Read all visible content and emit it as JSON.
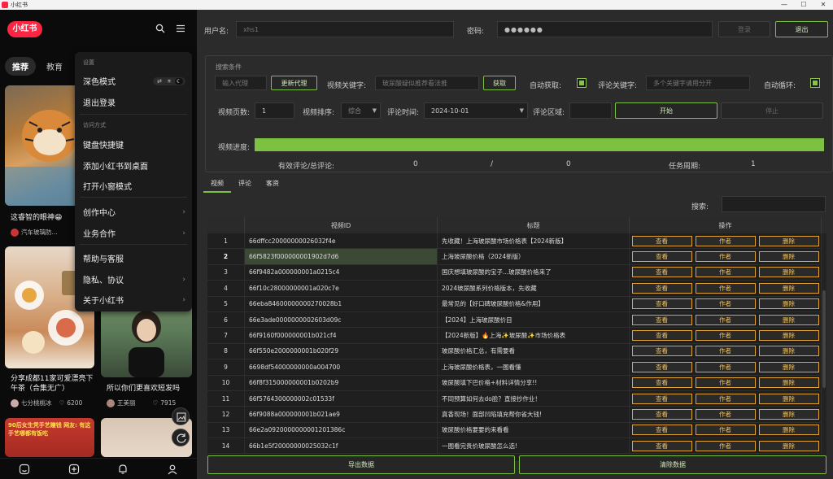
{
  "window": {
    "title": "小红书",
    "controls": [
      "—",
      "☐",
      "✕"
    ]
  },
  "left": {
    "logo": "小红书",
    "tabs": [
      {
        "label": "推荐",
        "active": true
      },
      {
        "label": "教育",
        "active": false
      }
    ],
    "cards": [
      {
        "title": "这睿智的眼神😁",
        "author": "汽车玻璃防..."
      },
      {
        "title": "分享成都11家可爱漂亮下午茶（合集无广）",
        "author": "七分桃桃冰",
        "likes": "6200"
      },
      {
        "title": "所以你们更喜欢短发吗",
        "author": "王美丽",
        "likes": "7915"
      },
      {
        "title": "90后女生凭手艺赚钱 网友: 有这手艺哪都有饭吃",
        "author": ""
      }
    ],
    "menu": {
      "section_settings": "设置",
      "dark_mode": "深色模式",
      "logout": "退出登录",
      "section_access": "访问方式",
      "shortcuts": "键盘快捷键",
      "add_desktop": "添加小红书到桌面",
      "mini_window": "打开小窗模式",
      "creator": "创作中心",
      "business": "业务合作",
      "help": "帮助与客服",
      "privacy": "隐私、协议",
      "about": "关于小红书",
      "chevron": "›",
      "theme_options": [
        "⇄",
        "☀",
        "☾"
      ]
    }
  },
  "right": {
    "username_label": "用户名:",
    "username_value": "xhs1",
    "password_label": "密码:",
    "password_value": "●●●●●●",
    "login_btn": "登录",
    "logout_btn": "退出",
    "search_cond": "搜索条件",
    "proxy_placeholder": "输入代理",
    "update_proxy": "更新代理",
    "video_kw_label": "视频关键字:",
    "video_kw_value": "玻尿酸疑似推荐看法推",
    "fetch_btn": "获取",
    "auto_fetch_label": "自动获取:",
    "comment_kw_label": "评论关键字:",
    "comment_kw_placeholder": "多个关键字请用分开",
    "auto_loop_label": "自动循环:",
    "pages_label": "视频页数:",
    "pages_value": "1",
    "sort_label": "视频排序:",
    "sort_value": "综合",
    "ctime_label": "评论时间:",
    "ctime_value": "2024-10-01",
    "region_label": "评论区域:",
    "start_btn": "开始",
    "stop_btn": "停止",
    "progress_label": "视频进度:",
    "progress_value": 1.0,
    "valid_label": "有效评论/总评论:",
    "valid_num": "0",
    "slash": "/",
    "total_num": "0",
    "period_label": "任务周期:",
    "period_value": "1",
    "subtabs": [
      {
        "label": "视频",
        "active": true
      },
      {
        "label": "评论",
        "active": false
      },
      {
        "label": "客资",
        "active": false
      }
    ],
    "search_label": "搜索:",
    "export_btn": "导出数据",
    "clear_btn": "清除数据",
    "accent": "#7cc141",
    "op_color": "#e3a330",
    "table": {
      "headers": [
        "",
        "视频ID",
        "标题",
        "操作"
      ],
      "ops": [
        "查看",
        "作者",
        "删除"
      ],
      "rows": [
        {
          "n": "1",
          "id": "66dffcc20000000026032f4e",
          "title": "先收藏！上海玻尿酸市场价格表【2024新版】"
        },
        {
          "n": "2",
          "id": "66f5823f000000001902d7d6",
          "title": "上海玻尿酸价格（2024新版）"
        },
        {
          "n": "3",
          "id": "66f9482a000000001a0215c4",
          "title": "国庆想填玻尿酸的宝子...玻尿酸价格来了"
        },
        {
          "n": "4",
          "id": "66f10c28000000001a020c7e",
          "title": "2024玻尿酸系列价格版本，先收藏"
        },
        {
          "n": "5",
          "id": "66eba84600000000270028b1",
          "title": "最常见的【好口碑玻尿酸价格&作用】"
        },
        {
          "n": "6",
          "id": "66e3ade0000000002603d09c",
          "title": "【2024】上海玻尿酸价目"
        },
        {
          "n": "7",
          "id": "66f9160f000000001b021cf4",
          "title": "【2024新版】🔥上海✨玻尿酸✨市场价格表"
        },
        {
          "n": "8",
          "id": "66f550e2000000001b020f29",
          "title": "玻尿酸价格汇总，有需要看"
        },
        {
          "n": "9",
          "id": "6698df54000000000a004700",
          "title": "上海玻尿酸价格表，一图看懂"
        },
        {
          "n": "10",
          "id": "66f8f315000000001b0202b9",
          "title": "玻尿酸填下巴价格+材料详情分享!!"
        },
        {
          "n": "11",
          "id": "66f5764300000002c01533f",
          "title": "不同预算如何去do脸？直接抄作业！"
        },
        {
          "n": "12",
          "id": "66f9088a000000001b021ae9",
          "title": "真香现场！面部凹陷填充帮你省大钱!"
        },
        {
          "n": "13",
          "id": "66e2a0920000000001201386c",
          "title": "玻尿酸价格要要的来看看"
        },
        {
          "n": "14",
          "id": "66b1e5f20000000025032c1f",
          "title": "一图看完贵价玻尿酸怎么选!"
        }
      ]
    }
  }
}
